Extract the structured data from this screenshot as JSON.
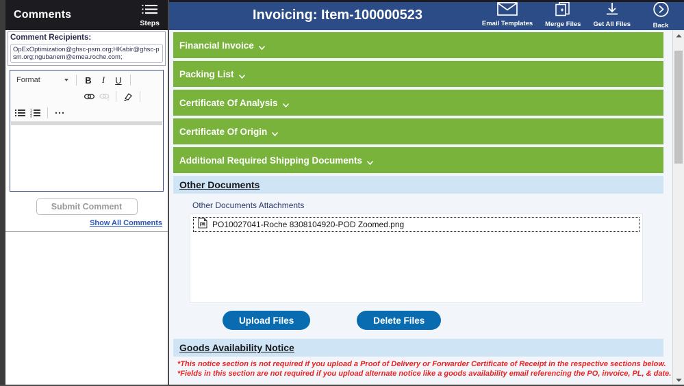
{
  "comments": {
    "title": "Comments",
    "steps_label": "Steps",
    "recipients_label": "Comment Recipients:",
    "recipients_value": "OpExOptimization@ghsc-psm.org;HKabir@ghsc-psm.org;ngubanem@emea.roche.com;",
    "toolbar": {
      "format_label": "Format",
      "bold_label": "B",
      "italic_label": "I",
      "underline_label": "U"
    },
    "editor_value": "",
    "submit_label": "Submit Comment",
    "show_all_label": "Show All Comments"
  },
  "header": {
    "title": "Invoicing: Item-100000523",
    "actions": [
      {
        "label": "Email Templates",
        "icon": "envelope-icon"
      },
      {
        "label": "Merge Files",
        "icon": "merge-files-icon"
      },
      {
        "label": "Get All Files",
        "icon": "download-arrow-icon"
      },
      {
        "label": "Back",
        "icon": "chevron-right-circle-icon"
      }
    ]
  },
  "sections": [
    {
      "label": "Financial Invoice",
      "state": "collapsed"
    },
    {
      "label": "Packing List",
      "state": "collapsed"
    },
    {
      "label": "Certificate Of Analysis",
      "state": "collapsed"
    },
    {
      "label": "Certificate Of Origin",
      "state": "collapsed"
    },
    {
      "label": "Additional Required Shipping Documents",
      "state": "collapsed"
    }
  ],
  "other_documents": {
    "heading": "Other Documents",
    "attachments_label": "Other Documents Attachments",
    "files": [
      {
        "name": "PO10027041-Roche 8308104920-POD Zoomed.png",
        "icon": "image-file-icon",
        "selected": true
      }
    ],
    "upload_label": "Upload Files",
    "delete_label": "Delete Files"
  },
  "goods_availability": {
    "heading": "Goods Availability Notice",
    "notes": [
      "*This notice section is not required if you upload a Proof of Delivery or Forwarder Certificate of Receipt in the respective sections below.",
      "*Fields in this section are not required if you upload alternate notice like a goods availability email referencing the PO, invoice, PL, & date."
    ]
  },
  "colors": {
    "navy": "#2b4c86",
    "green": "#7ab33b",
    "blue_band": "#cfe5f5",
    "button_blue": "#0a6cb0",
    "notice_red": "#ee2222"
  }
}
